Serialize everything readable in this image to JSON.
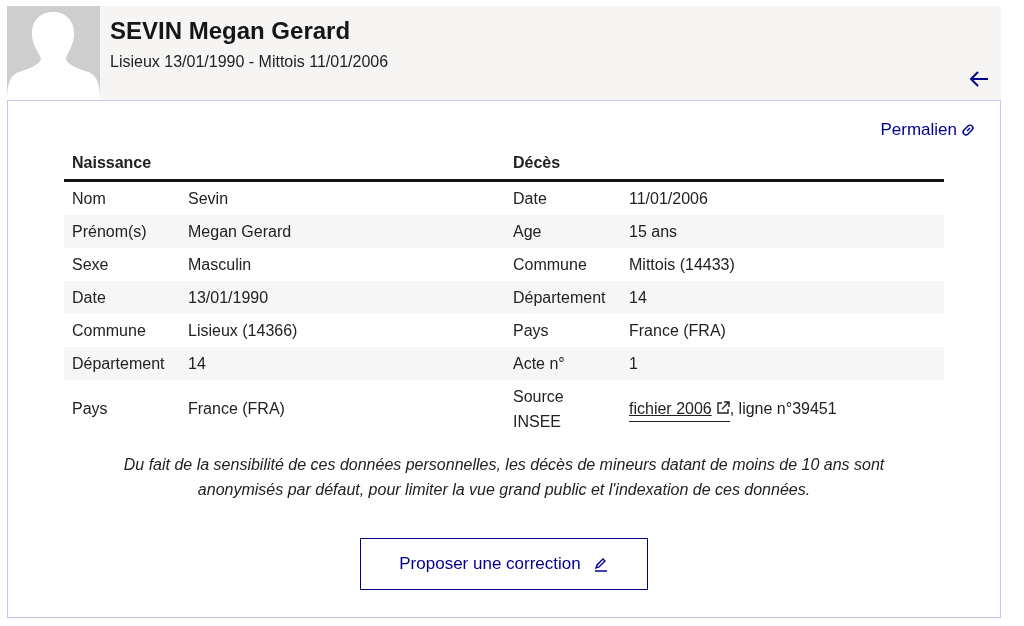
{
  "header": {
    "name": "SEVIN Megan Gerard",
    "subtitle": "Lisieux 13/01/1990 - Mittois 11/01/2006"
  },
  "permalink": "Permalien",
  "table": {
    "columns": [
      "Naissance",
      "Décès"
    ],
    "naissance": [
      {
        "label": "Nom",
        "value": "Sevin"
      },
      {
        "label": "Prénom(s)",
        "value": "Megan Gerard"
      },
      {
        "label": "Sexe",
        "value": "Masculin"
      },
      {
        "label": "Date",
        "value": "13/01/1990"
      },
      {
        "label": "Commune",
        "value": "Lisieux (14366)"
      },
      {
        "label": "Département",
        "value": "14"
      },
      {
        "label": "Pays",
        "value": "France (FRA)"
      }
    ],
    "deces": [
      {
        "label": "Date",
        "value": "11/01/2006"
      },
      {
        "label": "Age",
        "value": "15 ans"
      },
      {
        "label": "Commune",
        "value": "Mittois (14433)"
      },
      {
        "label": "Département",
        "value": "14"
      },
      {
        "label": "Pays",
        "value": "France (FRA)"
      },
      {
        "label": "Acte n°",
        "value": "1"
      },
      {
        "label": "Source INSEE",
        "link": "fichier 2006",
        "value": ", ligne n°39451"
      }
    ]
  },
  "note": "Du fait de la sensibilité de ces données personnelles, les décès de mineurs datant de moins de 10 ans sont anonymisés par défaut, pour limiter la vue grand public et l'indexation de ces données.",
  "button": "Proposer une correction"
}
